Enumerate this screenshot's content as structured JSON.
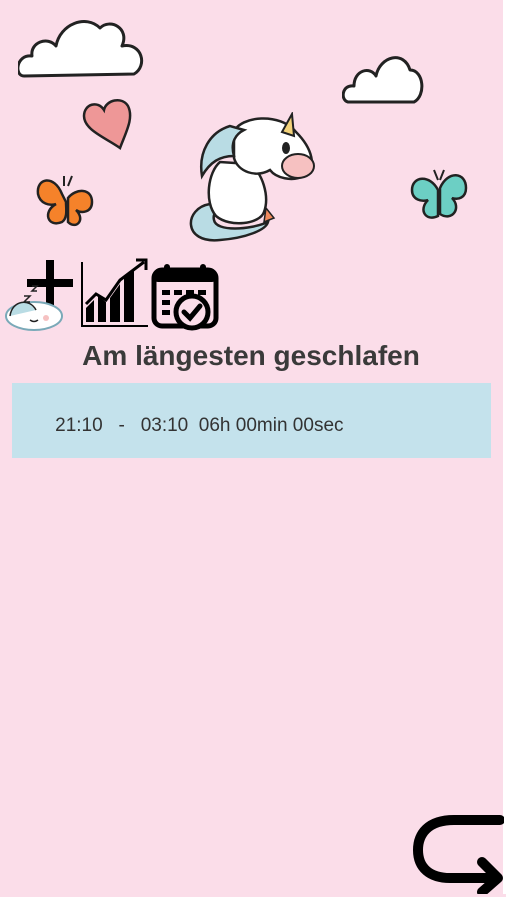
{
  "title": "Am längesten geschlafen",
  "record": {
    "start": "21:10",
    "separator": "-",
    "end": "03:10",
    "duration": "06h 00min 00sec"
  },
  "icons": {
    "add": "add-sleep-icon",
    "stats": "statistics-chart-icon",
    "calendar": "calendar-check-icon",
    "back": "back-arrow-icon"
  },
  "colors": {
    "background": "#fbdde9",
    "panel": "#c4e2ec",
    "text": "#333333",
    "icon": "#000000"
  }
}
